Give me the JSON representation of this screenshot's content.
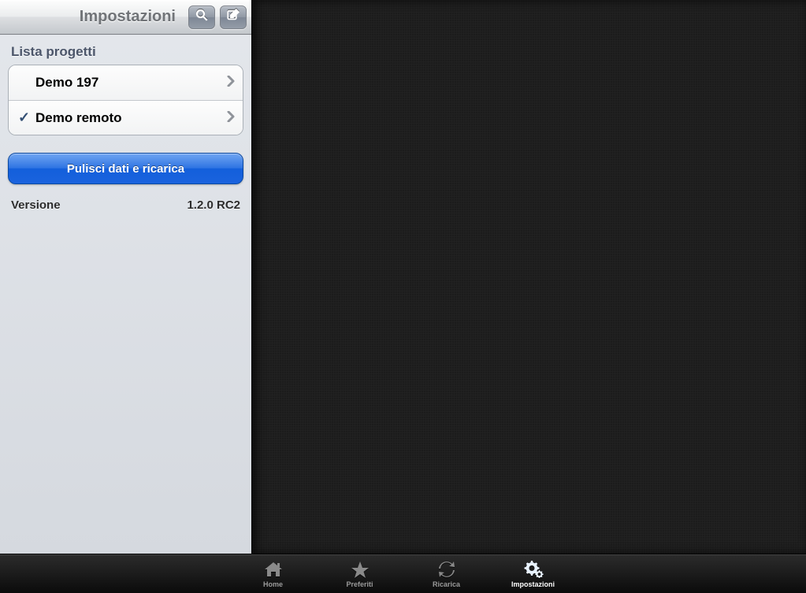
{
  "header": {
    "title": "Impostazioni"
  },
  "sidebar": {
    "section_title": "Lista progetti",
    "items": [
      {
        "label": "Demo 197",
        "checked": false
      },
      {
        "label": "Demo remoto",
        "checked": true
      }
    ],
    "primary_button": "Pulisci dati e ricarica",
    "version_label": "Versione",
    "version_value": "1.2.0 RC2"
  },
  "tabs": {
    "home": "Home",
    "favorites": "Preferiti",
    "reload": "Ricarica",
    "settings": "Impostazioni"
  }
}
